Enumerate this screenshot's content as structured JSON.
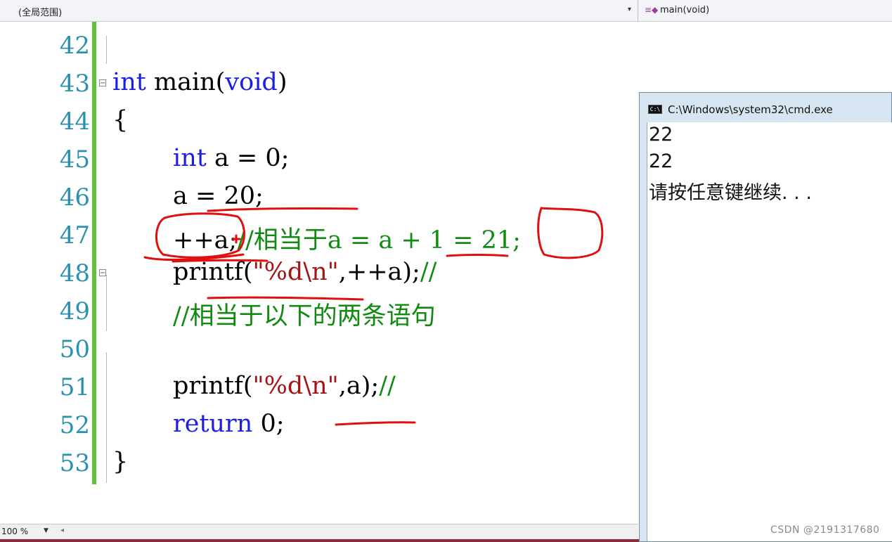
{
  "toolbar": {
    "scope": "(全局范围)",
    "function": "main(void)"
  },
  "editor": {
    "lines": [
      {
        "num": "42"
      },
      {
        "num": "43"
      },
      {
        "num": "44"
      },
      {
        "num": "45"
      },
      {
        "num": "46"
      },
      {
        "num": "47"
      },
      {
        "num": "48"
      },
      {
        "num": "49"
      },
      {
        "num": "50"
      },
      {
        "num": "51"
      },
      {
        "num": "52"
      },
      {
        "num": "53"
      }
    ],
    "code": {
      "l43_kw": "int",
      "l43_mid": " main(",
      "l43_kw2": "void",
      "l43_end": ")",
      "l44": "{",
      "l45_kw": "int",
      "l45_rest": " a = 0;",
      "l46": "a = 20;",
      "l47_code": "++a;",
      "l47_comment": "//相当于a = a + 1 = 21;",
      "l48_a": "printf(",
      "l48_str": "\"%d\\n\"",
      "l48_b": ",++a);",
      "l48_comment": "//",
      "l49_comment": "//相当于以下的两条语句",
      "l51_a": "printf(",
      "l51_str": "\"%d\\n\"",
      "l51_b": ",a);",
      "l51_comment": "//",
      "l52_kw": "return",
      "l52_rest": " 0;",
      "l53": "}"
    }
  },
  "status": {
    "zoom": "100 %"
  },
  "console": {
    "title": "C:\\Windows\\system32\\cmd.exe",
    "icon_label": "C:\\",
    "output": [
      "22",
      "22",
      "请按任意键继续. . ."
    ]
  },
  "watermark": "CSDN @2191317680",
  "colors": {
    "keyword": "#1c1ee0",
    "comment": "#118a11",
    "string": "#a31515",
    "line_number": "#2b91af",
    "annotation": "#e01010"
  }
}
